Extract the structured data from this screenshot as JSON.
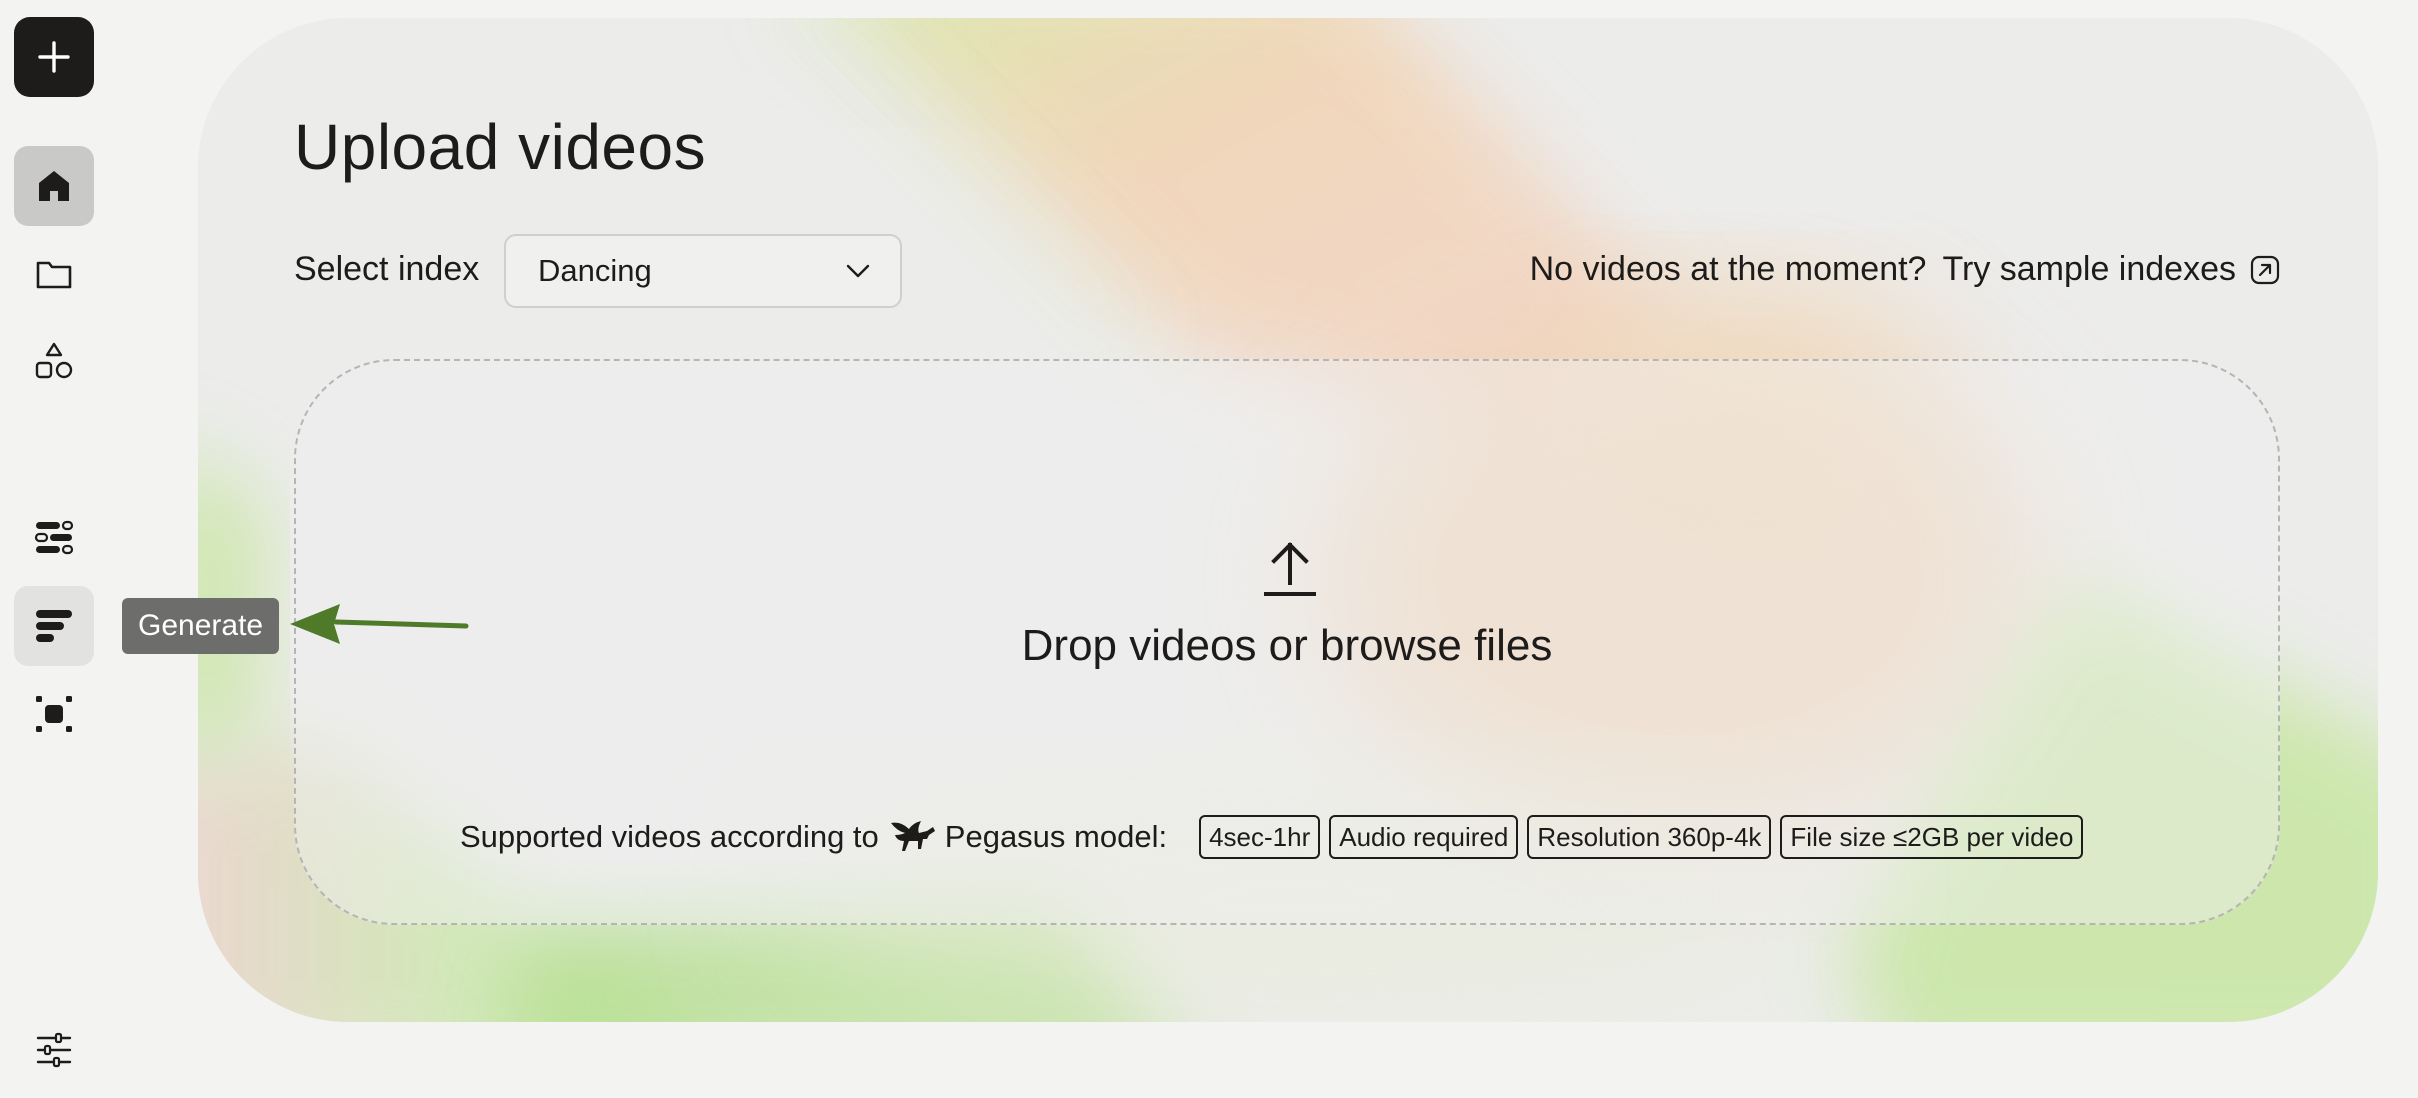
{
  "sidebar": {
    "new_button_icon": "plus-icon",
    "items": [
      {
        "icon": "home-icon",
        "state": "active"
      },
      {
        "icon": "folder-icon",
        "state": "default"
      },
      {
        "icon": "shapes-icon",
        "state": "default"
      },
      {
        "icon": "analyze-icon",
        "state": "default"
      },
      {
        "icon": "generate-icon",
        "state": "hover",
        "tooltip": "Generate"
      },
      {
        "icon": "embed-icon",
        "state": "default"
      }
    ],
    "settings_icon": "sliders-icon"
  },
  "annotation": {
    "arrow_color": "#4e7a2a"
  },
  "main": {
    "title": "Upload videos",
    "index": {
      "label": "Select index",
      "selected": "Dancing"
    },
    "sample": {
      "prompt": "No videos at the moment?",
      "link_label": "Try sample indexes"
    },
    "dropzone": {
      "text": "Drop videos or browse files",
      "supported_prefix": "Supported videos according to",
      "model_name": "Pegasus model:",
      "badges": [
        "4sec-1hr",
        "Audio required",
        "Resolution 360p-4k",
        "File size ≤2GB per video"
      ]
    }
  },
  "colors": {
    "primary": "#1d1c1b",
    "page_bg": "#f3f3f2",
    "tooltip_bg": "#6d6d6c",
    "accent_green": "#b8e08a",
    "accent_peach": "#f0cfae"
  }
}
